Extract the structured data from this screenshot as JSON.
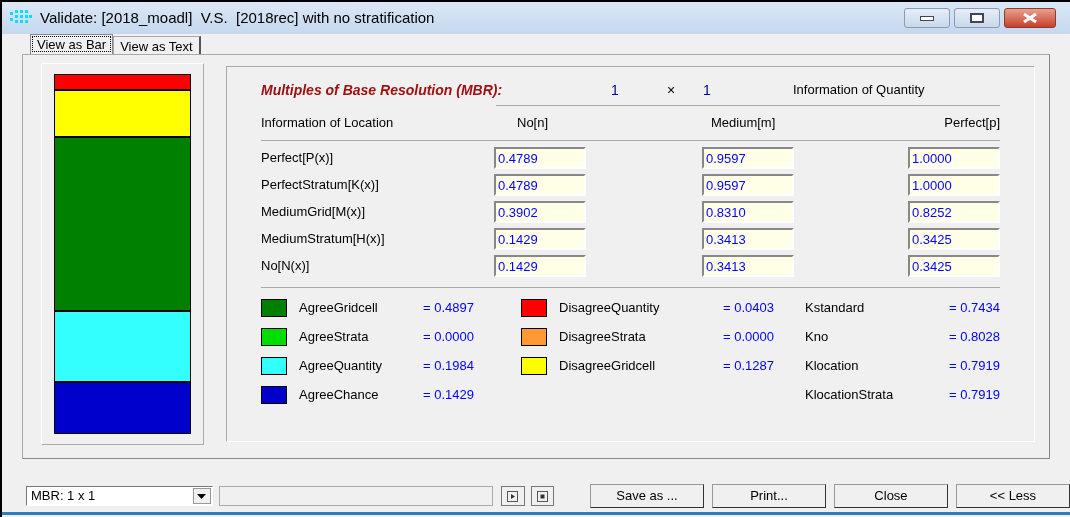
{
  "window": {
    "title": "Validate: [2018_moadl]  V.S.  [2018rec] with no stratification"
  },
  "tabs": [
    {
      "label": "View as Bar",
      "selected": true
    },
    {
      "label": "View as Text",
      "selected": false
    }
  ],
  "mbr": {
    "label": "Multiples of Base Resolution (MBR):",
    "rows": "1",
    "times": "×",
    "cols": "1"
  },
  "quantity_heading": "Information of Quantity",
  "table": {
    "columns": [
      "Information of Location",
      "No[n]",
      "Medium[m]",
      "Perfect[p]"
    ],
    "rows": [
      {
        "label": "Perfect[P(x)]",
        "values": [
          "0.4789",
          "0.9597",
          "1.0000"
        ]
      },
      {
        "label": "PerfectStratum[K(x)]",
        "values": [
          "0.4789",
          "0.9597",
          "1.0000"
        ]
      },
      {
        "label": "MediumGrid[M(x)]",
        "values": [
          "0.3902",
          "0.8310",
          "0.8252"
        ]
      },
      {
        "label": "MediumStratum[H(x)]",
        "values": [
          "0.1429",
          "0.3413",
          "0.3425"
        ]
      },
      {
        "label": "No[N(x)]",
        "values": [
          "0.1429",
          "0.3413",
          "0.3425"
        ]
      }
    ]
  },
  "legend": [
    {
      "label": "AgreeGridcell",
      "value": "= 0.4897",
      "color": "#008000"
    },
    {
      "label": "AgreeStrata",
      "value": "= 0.0000",
      "color": "#00dd00"
    },
    {
      "label": "AgreeQuantity",
      "value": "= 0.1984",
      "color": "#33ffff"
    },
    {
      "label": "AgreeChance",
      "value": "= 0.1429",
      "color": "#0000cc"
    },
    {
      "label": "DisagreeQuantity",
      "value": "= 0.0403",
      "color": "#ff0000"
    },
    {
      "label": "DisagreeStrata",
      "value": "= 0.0000",
      "color": "#ff9933"
    },
    {
      "label": "DisagreeGridcell",
      "value": "= 0.1287",
      "color": "#ffff00"
    }
  ],
  "statistics": [
    {
      "label": "Kstandard",
      "value": "= 0.7434"
    },
    {
      "label": "Kno",
      "value": "= 0.8028"
    },
    {
      "label": "Klocation",
      "value": "= 0.7919"
    },
    {
      "label": "KlocationStrata",
      "value": "= 0.7919"
    }
  ],
  "footer": {
    "mbr_select": "MBR: 1 x 1",
    "buttons": [
      "Save as ...",
      "Print...",
      "Close",
      "<< Less"
    ]
  }
}
